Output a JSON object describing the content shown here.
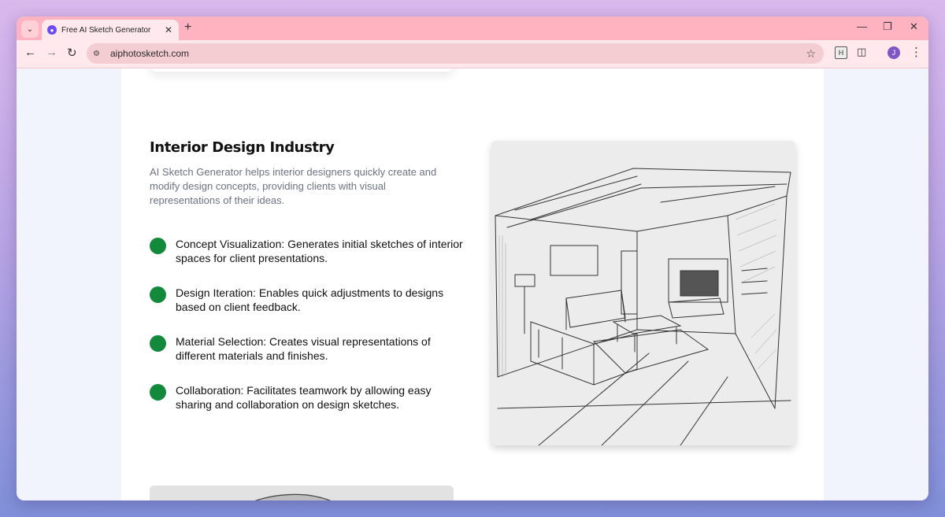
{
  "browser": {
    "tab_title": "Free AI Sketch Generator",
    "url": "aiphotosketch.com",
    "avatar_letter": "J",
    "extension_letter": "H"
  },
  "section": {
    "title": "Interior Design Industry",
    "description": "AI Sketch Generator helps interior designers quickly create and modify design concepts, providing clients with visual representations of their ideas.",
    "features": [
      "Concept Visualization: Generates initial sketches of interior spaces for client presentations.",
      "Design Iteration: Enables quick adjustments to designs based on client feedback.",
      "Material Selection: Creates visual representations of different materials and finishes.",
      "Collaboration: Facilitates teamwork by allowing easy sharing and collaboration on design sketches."
    ],
    "bullet_color": "#138a3b"
  },
  "colors": {
    "tabbar": "#ffb2bf",
    "toolbar": "#ffe9ec",
    "page_bg": "#f1f4fd"
  }
}
